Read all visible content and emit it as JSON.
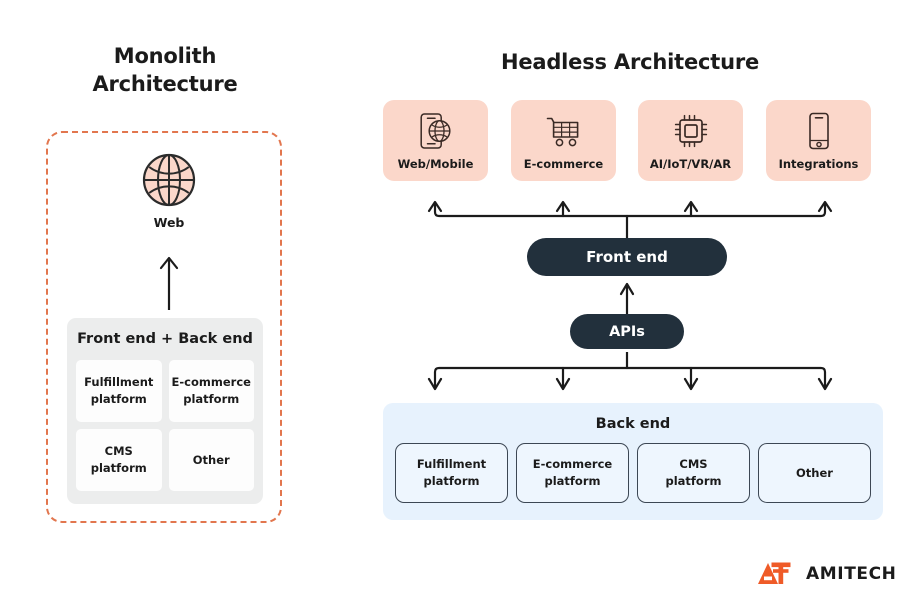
{
  "colors": {
    "accent_orange": "#e2764e",
    "card_peach": "#fbd7ca",
    "pill_navy": "#22303c",
    "backend_blue": "#e7f2fd",
    "panel_gray": "#eceded",
    "logo_orange": "#ef5b28",
    "text_dark": "#1b1b1b"
  },
  "monolith": {
    "title_line1": "Monolith",
    "title_line2": "Architecture",
    "web_node": {
      "icon": "globe-icon",
      "label": "Web"
    },
    "arrow_label": "up-arrow",
    "stack": {
      "title": "Front end + Back end",
      "cells": [
        {
          "label": "Fulfillment\nplatform"
        },
        {
          "label": "E-commerce\nplatform"
        },
        {
          "label": "CMS\nplatform"
        },
        {
          "label": "Other"
        }
      ]
    }
  },
  "headless": {
    "title": "Headless Architecture",
    "channels": [
      {
        "label": "Web/Mobile",
        "icon": "phone-globe-icon"
      },
      {
        "label": "E-commerce",
        "icon": "shopping-cart-icon"
      },
      {
        "label": "AI/IoT/VR/AR",
        "icon": "cpu-chip-icon"
      },
      {
        "label": "Integrations",
        "icon": "mobile-phone-icon"
      }
    ],
    "frontend_pill": "Front end",
    "apis_pill": "APIs",
    "backend": {
      "title": "Back end",
      "cells": [
        {
          "label": "Fulfillment\nplatform"
        },
        {
          "label": "E-commerce\nplatform"
        },
        {
          "label": "CMS\nplatform"
        },
        {
          "label": "Other"
        }
      ]
    }
  },
  "logo": {
    "mark": "amitech-mark",
    "word": "AMITECH"
  }
}
